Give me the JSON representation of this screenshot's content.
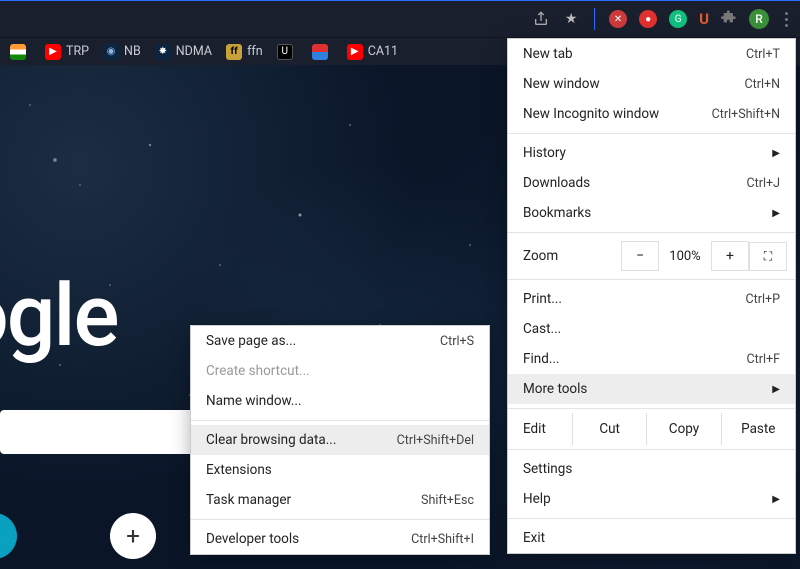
{
  "topbar": {
    "avatar_letter": "R"
  },
  "bookmarks": [
    {
      "label": "",
      "icon": "flag-in"
    },
    {
      "label": "TRP",
      "icon": "yt"
    },
    {
      "label": "NB",
      "icon": "nb"
    },
    {
      "label": "NDMA",
      "icon": "ndma"
    },
    {
      "label": "ffn",
      "icon": "ffn"
    },
    {
      "label": "",
      "icon": "tu"
    },
    {
      "label": "",
      "icon": "pix"
    },
    {
      "label": "CA11",
      "icon": "ca"
    }
  ],
  "logo_text": "ogle",
  "chips": {
    "add_label": "+"
  },
  "menu": {
    "new_tab": {
      "label": "New tab",
      "shortcut": "Ctrl+T"
    },
    "new_window": {
      "label": "New window",
      "shortcut": "Ctrl+N"
    },
    "incognito": {
      "label": "New Incognito window",
      "shortcut": "Ctrl+Shift+N"
    },
    "history": {
      "label": "History"
    },
    "downloads": {
      "label": "Downloads",
      "shortcut": "Ctrl+J"
    },
    "bookmarks_m": {
      "label": "Bookmarks"
    },
    "zoom": {
      "label": "Zoom",
      "minus": "−",
      "value": "100%",
      "plus": "+"
    },
    "print": {
      "label": "Print...",
      "shortcut": "Ctrl+P"
    },
    "cast": {
      "label": "Cast..."
    },
    "find": {
      "label": "Find...",
      "shortcut": "Ctrl+F"
    },
    "more_tools": {
      "label": "More tools"
    },
    "edit": {
      "label": "Edit",
      "cut": "Cut",
      "copy": "Copy",
      "paste": "Paste"
    },
    "settings": {
      "label": "Settings"
    },
    "help": {
      "label": "Help"
    },
    "exit": {
      "label": "Exit"
    }
  },
  "submenu": {
    "save_page": {
      "label": "Save page as...",
      "shortcut": "Ctrl+S"
    },
    "create_shortcut": {
      "label": "Create shortcut..."
    },
    "name_window": {
      "label": "Name window..."
    },
    "clear_data": {
      "label": "Clear browsing data...",
      "shortcut": "Ctrl+Shift+Del"
    },
    "extensions": {
      "label": "Extensions"
    },
    "task_manager": {
      "label": "Task manager",
      "shortcut": "Shift+Esc"
    },
    "dev_tools": {
      "label": "Developer tools",
      "shortcut": "Ctrl+Shift+I"
    }
  }
}
